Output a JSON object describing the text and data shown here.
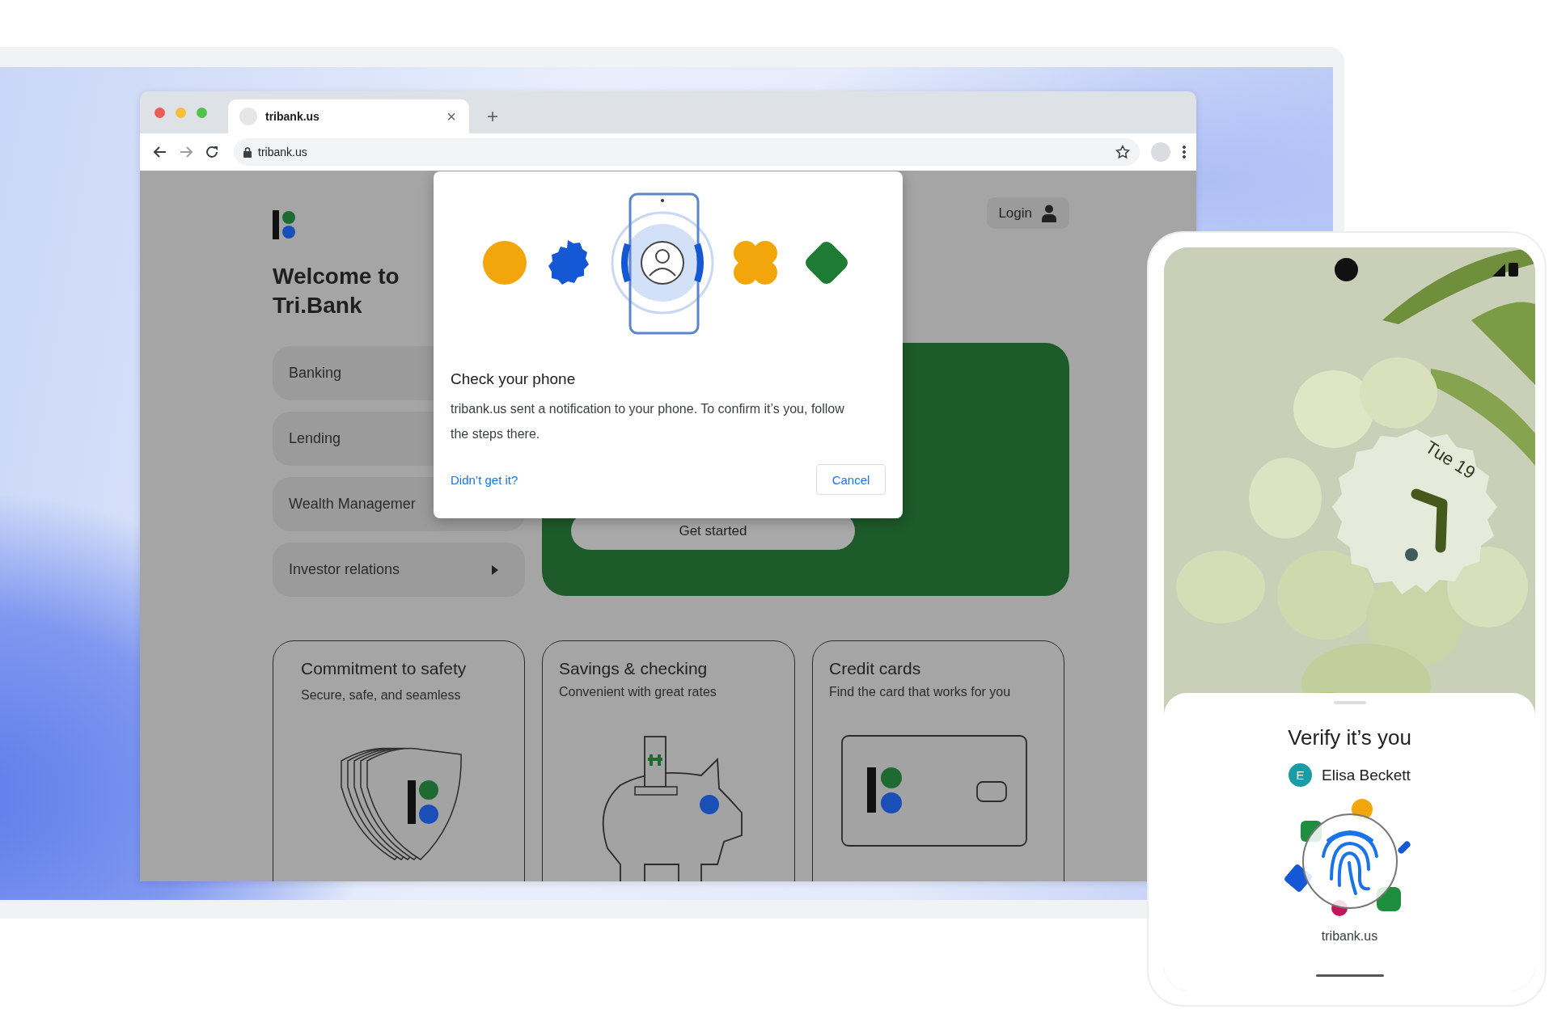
{
  "browser": {
    "tab": {
      "title": "tribank.us",
      "close": "×"
    },
    "new_tab": "+",
    "address": "tribank.us"
  },
  "page": {
    "heading": "Welcome to Tri.Bank",
    "login": "Login",
    "nav": [
      {
        "label": "Banking"
      },
      {
        "label": "Lending"
      },
      {
        "label": "Wealth Managemer"
      },
      {
        "label": "Investor relations",
        "has_arrow": true
      }
    ],
    "hero_button": "Get started",
    "cards": [
      {
        "title": "Commitment to safety",
        "subtitle": "Secure, safe, and seamless",
        "kind": "shield"
      },
      {
        "title": "Savings & checking",
        "subtitle": "Convenient with great rates",
        "kind": "piggy"
      },
      {
        "title": "Credit cards",
        "subtitle": "Find the card that works for you",
        "kind": "card"
      }
    ]
  },
  "dialog": {
    "title": "Check your phone",
    "body": "tribank.us sent a notification to your phone. To confirm it’s you, follow the steps there.",
    "link": "Didn’t get it?",
    "cancel": "Cancel"
  },
  "phone": {
    "date": "Tue 19",
    "sheet": {
      "title": "Verify it’s you",
      "account": {
        "initial": "E",
        "name": "Elisa Beckett"
      },
      "site": "tribank.us"
    }
  }
}
